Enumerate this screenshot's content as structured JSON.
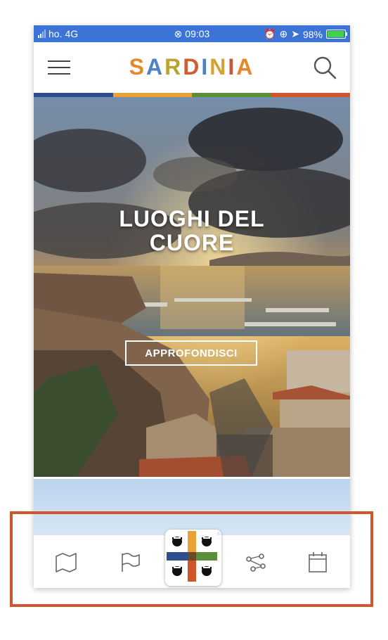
{
  "status_bar": {
    "carrier": "ho.",
    "network": "4G",
    "time": "09:03",
    "battery": "98%"
  },
  "header": {
    "logo_letters": [
      {
        "char": "S",
        "color": "#e3892c"
      },
      {
        "char": "A",
        "color": "#4e82c5"
      },
      {
        "char": "R",
        "color": "#b9a331"
      },
      {
        "char": "D",
        "color": "#d35d33"
      },
      {
        "char": "I",
        "color": "#4e82c5"
      },
      {
        "char": "N",
        "color": "#d4a233"
      },
      {
        "char": "I",
        "color": "#c9553a"
      },
      {
        "char": "A",
        "color": "#e3892c"
      }
    ],
    "menu_icon": "hamburger-icon",
    "search_icon": "search-icon"
  },
  "brand_stripe_colors": [
    "#2d4f8f",
    "#e8a235",
    "#5a8f3a",
    "#d0562b"
  ],
  "hero": {
    "title_line1": "LUOGHI DEL",
    "title_line2": "CUORE",
    "button_label": "APPROFONDISCI"
  },
  "tab_bar": {
    "tabs": [
      {
        "icon": "map-icon"
      },
      {
        "icon": "flag-icon"
      },
      {
        "icon": "four-moors-emblem-icon"
      },
      {
        "icon": "route-icon"
      },
      {
        "icon": "calendar-icon"
      }
    ],
    "highlight_color": "#d0562b"
  }
}
